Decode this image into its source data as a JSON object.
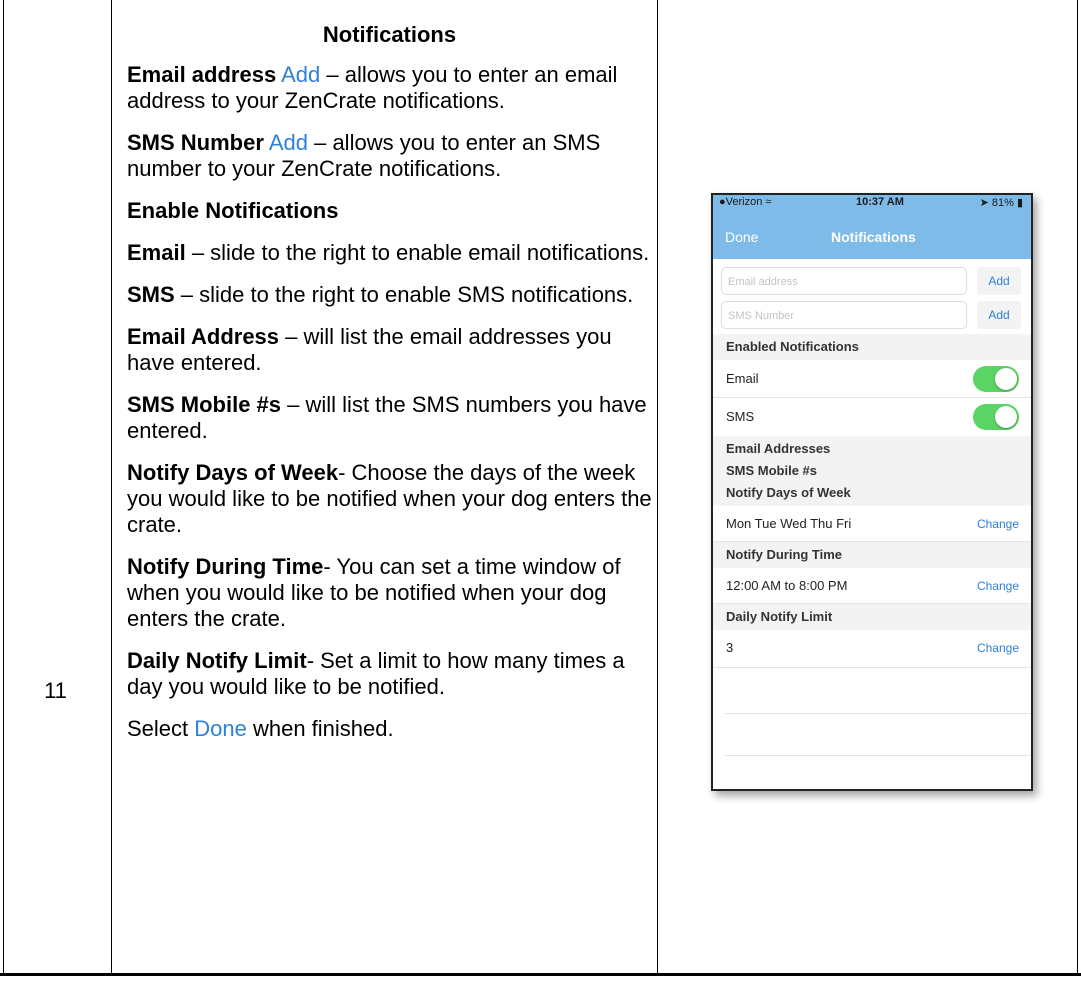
{
  "step": {
    "number": "11"
  },
  "doc": {
    "heading": "Notifications",
    "paragraphs": [
      {
        "bold": "Email address",
        "link": "Add",
        "text": " – allows you to enter an email address to your ZenCrate notifications."
      },
      {
        "bold": "SMS Number",
        "link": "Add",
        "text": " – allows you to enter an SMS number to your ZenCrate notifications."
      },
      {
        "bold": "Enable Notifications",
        "link": "",
        "text": ""
      },
      {
        "bold": "Email",
        "link": "",
        "text": " – slide to the right to enable email notifications."
      },
      {
        "bold": "SMS",
        "link": "",
        "text": " – slide to the right to enable SMS notifications."
      },
      {
        "bold": "Email Address",
        "link": "",
        "text": " – will list the email addresses you have entered."
      },
      {
        "bold": "SMS Mobile #s",
        "link": "",
        "text": " – will list the SMS numbers you have entered."
      },
      {
        "bold": "Notify Days of Week",
        "link": "",
        "text": "- Choose the days of the week you would like to be notified when your dog enters the crate."
      },
      {
        "bold": "Notify During Time",
        "link": "",
        "text": "- You can set a time window of when you would like to be notified when your dog enters the crate."
      },
      {
        "bold": "Daily Notify Limit",
        "link": "",
        "text": "- Set a limit to how many times a day you would like to be notified."
      }
    ],
    "closing": {
      "prefix": "Select ",
      "link": "Done",
      "suffix": " when finished."
    }
  },
  "phone": {
    "status": {
      "carrier": "Verizon",
      "time": "10:37 AM",
      "battery": "81%"
    },
    "nav": {
      "done": "Done",
      "title": "Notifications"
    },
    "email_placeholder": "Email address",
    "sms_placeholder": "SMS Number",
    "add_label": "Add",
    "enabled_header": "Enabled Notifications",
    "email_toggle_label": "Email",
    "sms_toggle_label": "SMS",
    "email_addresses_header": "Email Addresses",
    "sms_mobile_header": "SMS Mobile #s",
    "days_header": "Notify Days of Week",
    "days_value": "Mon Tue Wed Thu Fri",
    "time_header": "Notify During Time",
    "time_value": "12:00 AM to 8:00 PM",
    "limit_header": "Daily Notify Limit",
    "limit_value": "3",
    "change_label": "Change",
    "email_enabled": true,
    "sms_enabled": true,
    "accent_color": "#7fbbe8",
    "toggle_color": "#5ad464"
  }
}
